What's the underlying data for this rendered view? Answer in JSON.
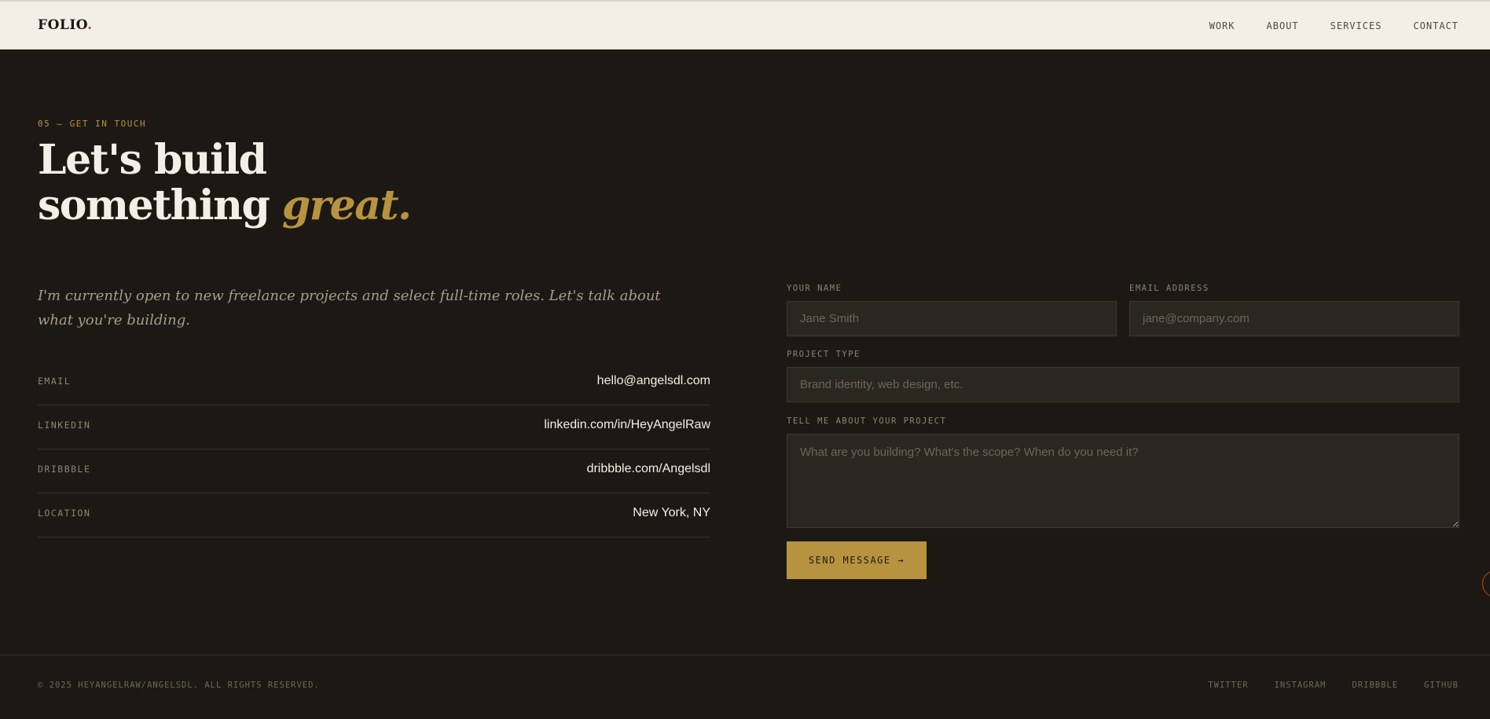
{
  "header": {
    "logo": "FOLIO",
    "logo_dot": ".",
    "nav": [
      {
        "label": "WORK"
      },
      {
        "label": "ABOUT"
      },
      {
        "label": "SERVICES"
      },
      {
        "label": "CONTACT"
      }
    ]
  },
  "hero": {
    "eyebrow": "05 — GET IN TOUCH",
    "title_line1": "Let's build",
    "title_line2": "something",
    "title_accent": "great."
  },
  "intro": "I'm currently open to new freelance projects and select full-time roles. Let's talk about what you're building.",
  "contact": [
    {
      "label": "EMAIL",
      "value": "hello@angelsdl.com"
    },
    {
      "label": "LINKEDIN",
      "value": "linkedin.com/in/HeyAngelRaw"
    },
    {
      "label": "DRIBBBLE",
      "value": "dribbble.com/Angelsdl"
    },
    {
      "label": "LOCATION",
      "value": "New York, NY"
    }
  ],
  "form": {
    "name_label": "YOUR NAME",
    "name_placeholder": "Jane Smith",
    "name_value": "",
    "email_label": "EMAIL ADDRESS",
    "email_placeholder": "jane@company.com",
    "email_value": "",
    "type_label": "PROJECT TYPE",
    "type_placeholder": "Brand identity, web design, etc.",
    "type_value": "",
    "message_label": "TELL ME ABOUT YOUR PROJECT",
    "message_placeholder": "What are you building? What's the scope? When do you need it?",
    "message_value": "",
    "submit_label": "SEND MESSAGE →"
  },
  "footer": {
    "copyright": "© 2025 HEYANGELRAW/ANGELSDL. ALL RIGHTS RESERVED.",
    "social": [
      {
        "label": "TWITTER"
      },
      {
        "label": "INSTAGRAM"
      },
      {
        "label": "DRIBBBLE"
      },
      {
        "label": "GITHUB"
      }
    ]
  },
  "colors": {
    "background": "#1c1914",
    "header_bg": "#f3efe7",
    "accent_gold": "#b8933f",
    "accent_red": "#c4421f"
  }
}
